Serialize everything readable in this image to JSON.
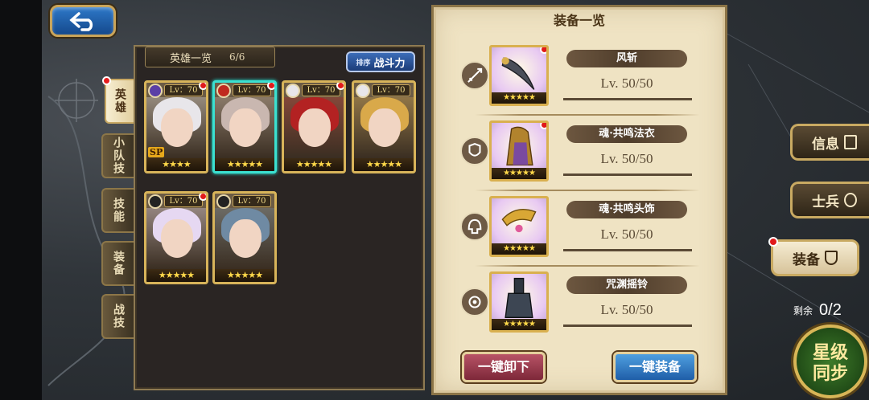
{
  "heroes": {
    "title": "英雄一览",
    "count": "6/6",
    "sort_prefix": "排序",
    "sort_label": "战斗力",
    "cards": [
      {
        "level": "Lv：70",
        "stars": "★★★★",
        "sp": "SP",
        "element_color": "#5b3fa6",
        "hair_color": "#e8e6ea",
        "badge": true
      },
      {
        "level": "Lv：70",
        "stars": "★★★★★",
        "element_color": "#c02a1f",
        "hair_color": "#c9b7b0",
        "badge": true,
        "selected": true
      },
      {
        "level": "Lv：70",
        "stars": "★★★★★",
        "element_color": "#e8e6ea",
        "hair_color": "#b32222",
        "badge": true
      },
      {
        "level": "Lv：70",
        "stars": "★★★★★",
        "element_color": "#e8e6ea",
        "hair_color": "#d9a94a",
        "badge": false
      },
      {
        "level": "Lv：70",
        "stars": "★★★★★",
        "element_color": "#222222",
        "hair_color": "#e6d8f2",
        "badge": true
      },
      {
        "level": "Lv：70",
        "stars": "★★★★★",
        "element_color": "#222222",
        "hair_color": "#6f8aa3",
        "badge": false
      }
    ]
  },
  "tabs": [
    {
      "label": "英雄",
      "active": true
    },
    {
      "label": "小队技"
    },
    {
      "label": "技能"
    },
    {
      "label": "装备"
    },
    {
      "label": "战技"
    }
  ],
  "equipment": {
    "title": "装备一览",
    "items": [
      {
        "name": "风斩",
        "level": "Lv. 50/50",
        "stars": "★★★★★",
        "type_icon": "sword-icon"
      },
      {
        "name": "魂·共鸣法衣",
        "level": "Lv. 50/50",
        "stars": "★★★★★",
        "type_icon": "armor-icon"
      },
      {
        "name": "魂·共鸣头饰",
        "level": "Lv. 50/50",
        "stars": "★★★★★",
        "type_icon": "helmet-icon"
      },
      {
        "name": "咒渊摇铃",
        "level": "Lv. 50/50",
        "stars": "★★★★★",
        "type_icon": "accessory-icon"
      }
    ],
    "unequip_all": "一键卸下",
    "equip_all": "一键装备"
  },
  "side": {
    "info": "信息",
    "soldier": "士兵",
    "equip": "装备",
    "remain_label": "剩余",
    "remain_value": "0/2",
    "star_sync": "星级同步"
  }
}
